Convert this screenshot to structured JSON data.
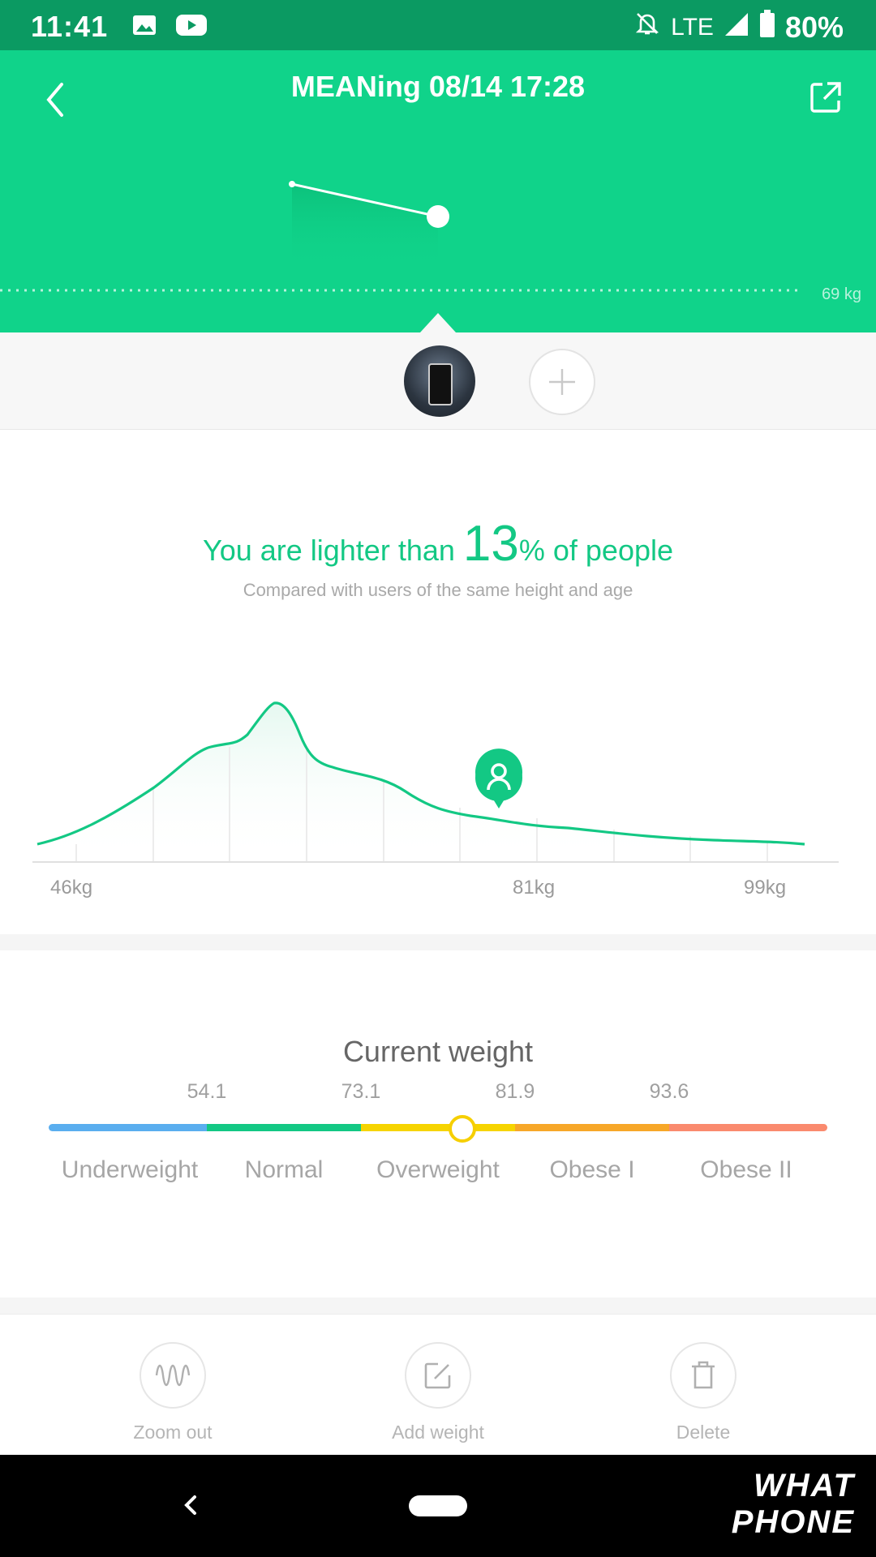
{
  "status_bar": {
    "time": "11:41",
    "network": "LTE",
    "battery": "80%"
  },
  "header": {
    "title": "MEANing 08/14 17:28",
    "reference_label": "69 kg"
  },
  "comparison": {
    "headline_prefix": "You are lighter than ",
    "percent": "13",
    "headline_suffix": "% of people",
    "subtitle": "Compared with users of the same height and age",
    "ticks": [
      "46kg",
      "81kg",
      "99kg"
    ]
  },
  "chart_data": {
    "type": "area",
    "x_ticks": [
      "46kg",
      "81kg",
      "99kg"
    ],
    "user_marker_position_kg": 78,
    "accent_color": "#13c884"
  },
  "current_weight": {
    "title": "Current weight",
    "thresholds": [
      "54.1",
      "73.1",
      "81.9",
      "93.6"
    ],
    "categories": [
      "Underweight",
      "Normal",
      "Overweight",
      "Obese I",
      "Obese II"
    ],
    "current_category": "Overweight",
    "colors": [
      "#5aaeef",
      "#13c884",
      "#f6d400",
      "#f7a728",
      "#fa8a6e"
    ]
  },
  "actions": [
    {
      "label": "Zoom out",
      "icon": "waveform-icon"
    },
    {
      "label": "Add weight",
      "icon": "edit-icon"
    },
    {
      "label": "Delete",
      "icon": "trash-icon"
    }
  ],
  "watermark": "WHAT PHONE"
}
